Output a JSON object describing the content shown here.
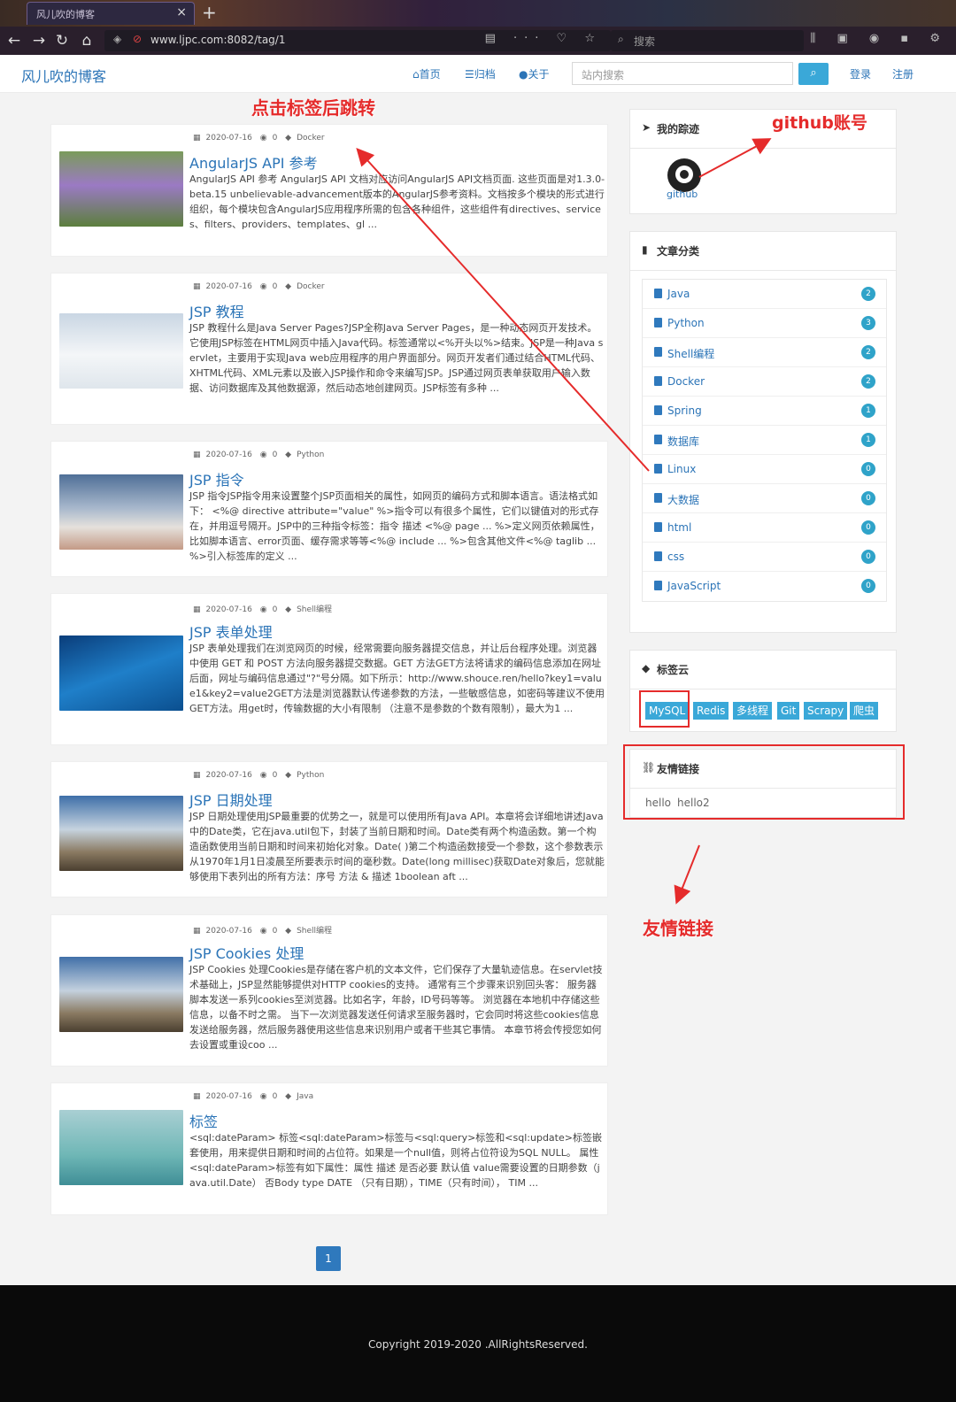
{
  "browser": {
    "tab_title": "风儿吹的博客",
    "url": "www.ljpc.com:8082/tag/1",
    "search_placeholder": "搜索"
  },
  "site": {
    "brand": "风儿吹的博客",
    "nav": [
      "首页",
      "归档",
      "关于"
    ],
    "search_placeholder": "站内搜索",
    "login": "登录",
    "register": "注册"
  },
  "annotations": {
    "tag_jump": "点击标签后跳转",
    "github_account": "github账号",
    "friend_links": "友情链接"
  },
  "articles": [
    {
      "date": "2020-07-16",
      "views": "0",
      "category": "Docker",
      "title": "AngularJS API 参考",
      "excerpt": "AngularJS API 参考 AngularJS API 文档对应访问AngularJS API文档页面. 这些页面是对1.3.0-beta.15 unbelievable-advancement版本的AngularJS参考资料。文档按多个模块的形式进行组织，每个模块包含AngularJS应用程序所需的包含各种组件，这些组件有directives、services、filters、providers、templates、gl ..."
    },
    {
      "date": "2020-07-16",
      "views": "0",
      "category": "Docker",
      "title": "JSP 教程",
      "excerpt": "JSP 教程什么是Java Server Pages?JSP全称Java Server Pages，是一种动态网页开发技术。它使用JSP标签在HTML网页中插入Java代码。标签通常以<%开头以%>结束。JSP是一种Java servlet，主要用于实现Java web应用程序的用户界面部分。网页开发者们通过结合HTML代码、XHTML代码、XML元素以及嵌入JSP操作和命令来编写JSP。JSP通过网页表单获取用户输入数据、访问数据库及其他数据源，然后动态地创建网页。JSP标签有多种 ..."
    },
    {
      "date": "2020-07-16",
      "views": "0",
      "category": "Python",
      "title": "JSP 指令",
      "excerpt": "JSP 指令JSP指令用来设置整个JSP页面相关的属性，如网页的编码方式和脚本语言。语法格式如下： <%@ directive attribute=\"value\" %>指令可以有很多个属性，它们以键值对的形式存在，并用逗号隔开。JSP中的三种指令标签：指令 描述 <%@ page ... %>定义网页依赖属性，比如脚本语言、error页面、缓存需求等等<%@ include ... %>包含其他文件<%@ taglib ... %>引入标签库的定义 ..."
    },
    {
      "date": "2020-07-16",
      "views": "0",
      "category": "Shell编程",
      "title": "JSP 表单处理",
      "excerpt": "JSP 表单处理我们在浏览网页的时候，经常需要向服务器提交信息，并让后台程序处理。浏览器中使用 GET 和 POST 方法向服务器提交数据。GET 方法GET方法将请求的编码信息添加在网址后面，网址与编码信息通过\"?\"号分隔。如下所示：http://www.shouce.ren/hello?key1=value1&key2=value2GET方法是浏览器默认传递参数的方法，一些敏感信息，如密码等建议不使用GET方法。用get时，传输数据的大小有限制 （注意不是参数的个数有限制），最大为1 ..."
    },
    {
      "date": "2020-07-16",
      "views": "0",
      "category": "Python",
      "title": "JSP 日期处理",
      "excerpt": "JSP 日期处理使用JSP最重要的优势之一，就是可以使用所有Java  API。本章将会详细地讲述Java中的Date类，它在java.util包下，封装了当前日期和时间。Date类有两个构造函数。第一个构造函数使用当前日期和时间来初始化对象。Date( )第二个构造函数接受一个参数，这个参数表示从1970年1月1日凌晨至所要表示时间的毫秒数。Date(long millisec)获取Date对象后，您就能够使用下表列出的所有方法：序号 方法 & 描述 1boolean aft ..."
    },
    {
      "date": "2020-07-16",
      "views": "0",
      "category": "Shell编程",
      "title": "JSP Cookies 处理",
      "excerpt": "JSP Cookies 处理Cookies是存储在客户机的文本文件，它们保存了大量轨迹信息。在servlet技术基础上，JSP显然能够提供对HTTP cookies的支持。 通常有三个步骤来识别回头客： 服务器脚本发送一系列cookies至浏览器。比如名字，年龄，ID号码等等。 浏览器在本地机中存储这些信息，以备不时之需。 当下一次浏览器发送任何请求至服务器时，它会同时将这些cookies信息发送给服务器，然后服务器使用这些信息来识别用户或者干些其它事情。 本章节将会传授您如何去设置或重设coo ..."
    },
    {
      "date": "2020-07-16",
      "views": "0",
      "category": "Java",
      "title": "标签",
      "excerpt": "<sql:dateParam> 标签<sql:dateParam>标签与<sql:query>标签和<sql:update>标签嵌套使用，用来提供日期和时间的占位符。如果是一个null值，则将占位符设为SQL NULL。 属性<sql:dateParam>标签有如下属性：属性 描述 是否必要 默认值 value需要设置的日期参数（java.util.Date） 否Body type DATE （只有日期），TIME（只有时间）， TIM ..."
    }
  ],
  "pagination": {
    "current": "1"
  },
  "sidebar": {
    "tracks": {
      "title": "我的踪迹",
      "github_label": "github"
    },
    "categories": {
      "title": "文章分类",
      "items": [
        {
          "name": "Java",
          "count": "2"
        },
        {
          "name": "Python",
          "count": "3"
        },
        {
          "name": "Shell编程",
          "count": "2"
        },
        {
          "name": "Docker",
          "count": "2"
        },
        {
          "name": "Spring",
          "count": "1"
        },
        {
          "name": "数据库",
          "count": "1"
        },
        {
          "name": "Linux",
          "count": "0"
        },
        {
          "name": "大数据",
          "count": "0"
        },
        {
          "name": "html",
          "count": "0"
        },
        {
          "name": "css",
          "count": "0"
        },
        {
          "name": "JavaScript",
          "count": "0"
        }
      ]
    },
    "tag_cloud": {
      "title": "标签云",
      "tags": [
        "MySQL",
        "Redis",
        "多线程",
        "Git",
        "Scrapy",
        "爬虫"
      ]
    },
    "friend_links": {
      "title": "友情链接",
      "links": [
        "hello",
        "hello2"
      ]
    }
  },
  "footer": {
    "copyright": "Copyright 2019-2020 .AllRightsReserved."
  },
  "colors": {
    "accent": "#2b74b7",
    "badge": "#2fa3c9",
    "tag": "#3aa8d8",
    "annotation": "#e52b2b"
  }
}
